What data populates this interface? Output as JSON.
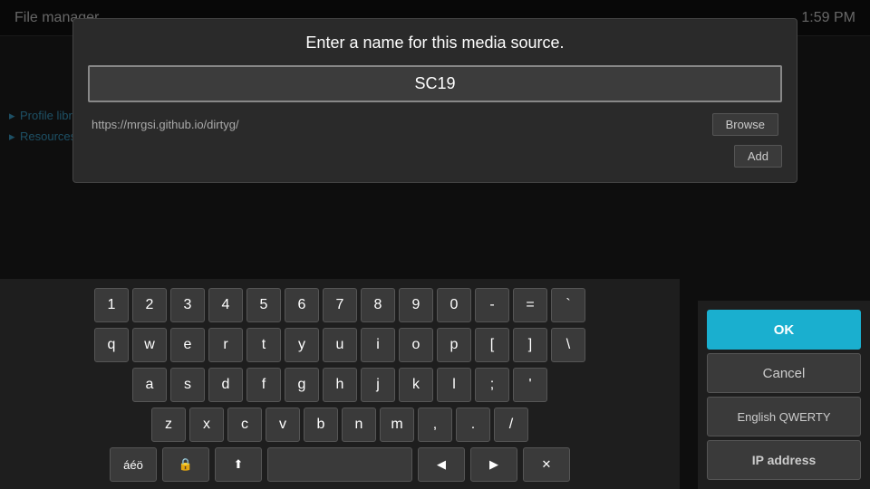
{
  "topbar": {
    "title": "File manager",
    "time": "1:59 PM"
  },
  "dialog": {
    "prompt": "Enter a name for this media source.",
    "input_value": "SC19",
    "source_url": "https://mrgsi.github.io/dirtyg/",
    "browse_label": "Browse",
    "add_label": "Add"
  },
  "sidebar": {
    "items": [
      {
        "label": "Profile library"
      },
      {
        "label": "Resources"
      }
    ]
  },
  "keyboard": {
    "rows": [
      [
        "1",
        "2",
        "3",
        "4",
        "5",
        "6",
        "7",
        "8",
        "9",
        "0",
        "-",
        "=",
        "`"
      ],
      [
        "q",
        "w",
        "e",
        "r",
        "t",
        "y",
        "u",
        "i",
        "o",
        "p",
        "[",
        "]",
        "\\"
      ],
      [
        "a",
        "s",
        "d",
        "f",
        "g",
        "h",
        "j",
        "k",
        "l",
        ";",
        "'"
      ],
      [
        "z",
        "x",
        "c",
        "v",
        "b",
        "n",
        "m",
        ",",
        ".",
        "/"
      ]
    ],
    "bottom": {
      "special1": "áéö",
      "shift_lock": "🔒",
      "shift": "⬆",
      "space": "",
      "left": "◀",
      "right": "▶",
      "backspace": "✕"
    }
  },
  "right_panel": {
    "ok_label": "OK",
    "cancel_label": "Cancel",
    "lang_label": "English QWERTY",
    "ip_label": "IP address"
  }
}
